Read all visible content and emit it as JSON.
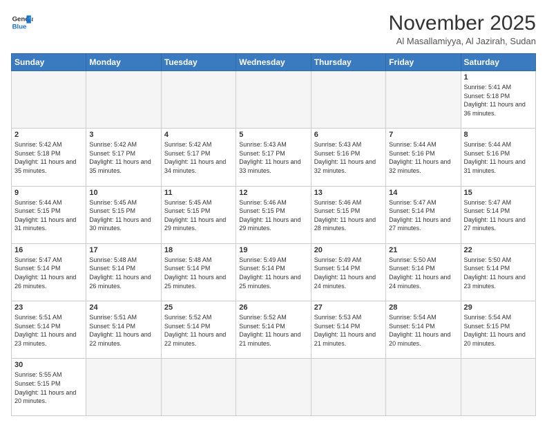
{
  "header": {
    "logo_general": "General",
    "logo_blue": "Blue",
    "title": "November 2025",
    "subtitle": "Al Masallamiyya, Al Jazirah, Sudan"
  },
  "weekdays": [
    "Sunday",
    "Monday",
    "Tuesday",
    "Wednesday",
    "Thursday",
    "Friday",
    "Saturday"
  ],
  "days": [
    {
      "num": "",
      "info": ""
    },
    {
      "num": "",
      "info": ""
    },
    {
      "num": "",
      "info": ""
    },
    {
      "num": "",
      "info": ""
    },
    {
      "num": "",
      "info": ""
    },
    {
      "num": "",
      "info": ""
    },
    {
      "num": "1",
      "sunrise": "Sunrise: 5:41 AM",
      "sunset": "Sunset: 5:18 PM",
      "daylight": "Daylight: 11 hours and 36 minutes."
    },
    {
      "num": "2",
      "sunrise": "Sunrise: 5:42 AM",
      "sunset": "Sunset: 5:18 PM",
      "daylight": "Daylight: 11 hours and 35 minutes."
    },
    {
      "num": "3",
      "sunrise": "Sunrise: 5:42 AM",
      "sunset": "Sunset: 5:17 PM",
      "daylight": "Daylight: 11 hours and 35 minutes."
    },
    {
      "num": "4",
      "sunrise": "Sunrise: 5:42 AM",
      "sunset": "Sunset: 5:17 PM",
      "daylight": "Daylight: 11 hours and 34 minutes."
    },
    {
      "num": "5",
      "sunrise": "Sunrise: 5:43 AM",
      "sunset": "Sunset: 5:17 PM",
      "daylight": "Daylight: 11 hours and 33 minutes."
    },
    {
      "num": "6",
      "sunrise": "Sunrise: 5:43 AM",
      "sunset": "Sunset: 5:16 PM",
      "daylight": "Daylight: 11 hours and 32 minutes."
    },
    {
      "num": "7",
      "sunrise": "Sunrise: 5:44 AM",
      "sunset": "Sunset: 5:16 PM",
      "daylight": "Daylight: 11 hours and 32 minutes."
    },
    {
      "num": "8",
      "sunrise": "Sunrise: 5:44 AM",
      "sunset": "Sunset: 5:16 PM",
      "daylight": "Daylight: 11 hours and 31 minutes."
    },
    {
      "num": "9",
      "sunrise": "Sunrise: 5:44 AM",
      "sunset": "Sunset: 5:15 PM",
      "daylight": "Daylight: 11 hours and 31 minutes."
    },
    {
      "num": "10",
      "sunrise": "Sunrise: 5:45 AM",
      "sunset": "Sunset: 5:15 PM",
      "daylight": "Daylight: 11 hours and 30 minutes."
    },
    {
      "num": "11",
      "sunrise": "Sunrise: 5:45 AM",
      "sunset": "Sunset: 5:15 PM",
      "daylight": "Daylight: 11 hours and 29 minutes."
    },
    {
      "num": "12",
      "sunrise": "Sunrise: 5:46 AM",
      "sunset": "Sunset: 5:15 PM",
      "daylight": "Daylight: 11 hours and 29 minutes."
    },
    {
      "num": "13",
      "sunrise": "Sunrise: 5:46 AM",
      "sunset": "Sunset: 5:15 PM",
      "daylight": "Daylight: 11 hours and 28 minutes."
    },
    {
      "num": "14",
      "sunrise": "Sunrise: 5:47 AM",
      "sunset": "Sunset: 5:14 PM",
      "daylight": "Daylight: 11 hours and 27 minutes."
    },
    {
      "num": "15",
      "sunrise": "Sunrise: 5:47 AM",
      "sunset": "Sunset: 5:14 PM",
      "daylight": "Daylight: 11 hours and 27 minutes."
    },
    {
      "num": "16",
      "sunrise": "Sunrise: 5:47 AM",
      "sunset": "Sunset: 5:14 PM",
      "daylight": "Daylight: 11 hours and 26 minutes."
    },
    {
      "num": "17",
      "sunrise": "Sunrise: 5:48 AM",
      "sunset": "Sunset: 5:14 PM",
      "daylight": "Daylight: 11 hours and 26 minutes."
    },
    {
      "num": "18",
      "sunrise": "Sunrise: 5:48 AM",
      "sunset": "Sunset: 5:14 PM",
      "daylight": "Daylight: 11 hours and 25 minutes."
    },
    {
      "num": "19",
      "sunrise": "Sunrise: 5:49 AM",
      "sunset": "Sunset: 5:14 PM",
      "daylight": "Daylight: 11 hours and 25 minutes."
    },
    {
      "num": "20",
      "sunrise": "Sunrise: 5:49 AM",
      "sunset": "Sunset: 5:14 PM",
      "daylight": "Daylight: 11 hours and 24 minutes."
    },
    {
      "num": "21",
      "sunrise": "Sunrise: 5:50 AM",
      "sunset": "Sunset: 5:14 PM",
      "daylight": "Daylight: 11 hours and 24 minutes."
    },
    {
      "num": "22",
      "sunrise": "Sunrise: 5:50 AM",
      "sunset": "Sunset: 5:14 PM",
      "daylight": "Daylight: 11 hours and 23 minutes."
    },
    {
      "num": "23",
      "sunrise": "Sunrise: 5:51 AM",
      "sunset": "Sunset: 5:14 PM",
      "daylight": "Daylight: 11 hours and 23 minutes."
    },
    {
      "num": "24",
      "sunrise": "Sunrise: 5:51 AM",
      "sunset": "Sunset: 5:14 PM",
      "daylight": "Daylight: 11 hours and 22 minutes."
    },
    {
      "num": "25",
      "sunrise": "Sunrise: 5:52 AM",
      "sunset": "Sunset: 5:14 PM",
      "daylight": "Daylight: 11 hours and 22 minutes."
    },
    {
      "num": "26",
      "sunrise": "Sunrise: 5:52 AM",
      "sunset": "Sunset: 5:14 PM",
      "daylight": "Daylight: 11 hours and 21 minutes."
    },
    {
      "num": "27",
      "sunrise": "Sunrise: 5:53 AM",
      "sunset": "Sunset: 5:14 PM",
      "daylight": "Daylight: 11 hours and 21 minutes."
    },
    {
      "num": "28",
      "sunrise": "Sunrise: 5:54 AM",
      "sunset": "Sunset: 5:14 PM",
      "daylight": "Daylight: 11 hours and 20 minutes."
    },
    {
      "num": "29",
      "sunrise": "Sunrise: 5:54 AM",
      "sunset": "Sunset: 5:15 PM",
      "daylight": "Daylight: 11 hours and 20 minutes."
    },
    {
      "num": "30",
      "sunrise": "Sunrise: 5:55 AM",
      "sunset": "Sunset: 5:15 PM",
      "daylight": "Daylight: 11 hours and 20 minutes."
    }
  ]
}
